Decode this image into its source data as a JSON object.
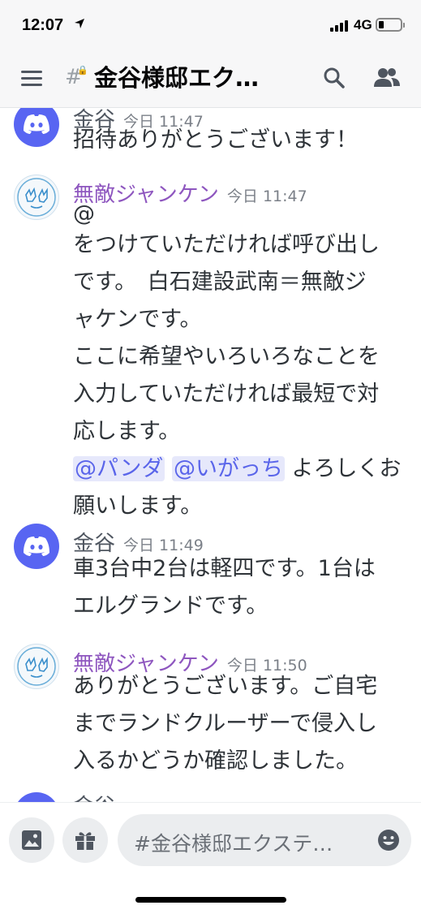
{
  "status": {
    "time": "12:07",
    "network": "4G"
  },
  "header": {
    "title": "金谷様邸エク…"
  },
  "messages": [
    {
      "author": "金谷",
      "time": "今日 11:47",
      "lines": [
        "招待ありがとうございます！"
      ]
    },
    {
      "author": "無敵ジャンケン",
      "time": "今日 11:47",
      "lines": [
        "@",
        "をつけていただければ呼び出し",
        "です。　白石建設武南＝無敵ジ",
        "ャケンです。",
        "ここに希望やいろいろなことを",
        "入力していただければ最短で対",
        "応します。"
      ],
      "mentions": [
        "@パンダ",
        "@いがっち"
      ],
      "after_mentions": "よろしくお",
      "last_line": "願いします。"
    },
    {
      "author": "金谷",
      "time": "今日 11:49",
      "lines": [
        "車3台中2台は軽四です。1台は",
        "エルグランドです。"
      ]
    },
    {
      "author": "無敵ジャンケン",
      "time": "今日 11:50",
      "lines": [
        "ありがとうございます。ご自宅",
        "までランドクルーザーで侵入し",
        "入るかどうか確認しました。"
      ]
    },
    {
      "author": "金谷"
    }
  ],
  "composer": {
    "placeholder": "#金谷様邸エクステ…"
  },
  "colors": {
    "discord_blurple": "#5865f2",
    "mention_bg": "#e6e8fb",
    "author_purple": "#8e56bf"
  }
}
